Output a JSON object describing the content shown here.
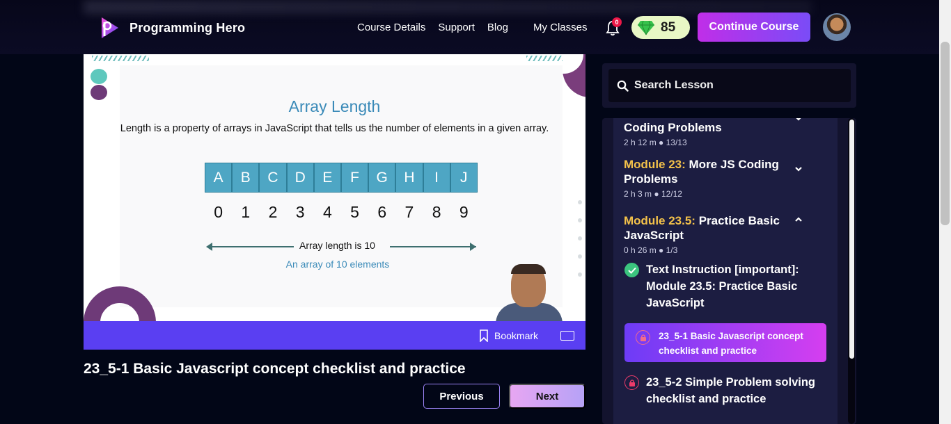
{
  "nav": {
    "brand": "Programming Hero",
    "links": [
      "Course Details",
      "Support",
      "Blog",
      "My Classes"
    ],
    "notification_count": "0",
    "gems": "85",
    "continue_label": "Continue Course"
  },
  "video": {
    "slide_title": "Array Length",
    "slide_subtitle": "Length is a property of arrays in JavaScript that tells us the number of elements in a given array.",
    "cells": [
      "A",
      "B",
      "C",
      "D",
      "E",
      "F",
      "G",
      "H",
      "I",
      "J"
    ],
    "indices": [
      "0",
      "1",
      "2",
      "3",
      "4",
      "5",
      "6",
      "7",
      "8",
      "9"
    ],
    "length_label": "Array length is 10",
    "elements_label": "An array of 10 elements",
    "bookmark_label": "Bookmark"
  },
  "lesson": {
    "title": "23_5-1 Basic Javascript concept checklist and practice",
    "prev_label": "Previous",
    "next_label": "Next"
  },
  "sidebar": {
    "search_placeholder": "Search Lesson",
    "modules": [
      {
        "num": "",
        "name": "Coding Problems",
        "duration": "2 h 12 m",
        "progress": "13/13"
      },
      {
        "num": "Module 23:",
        "name": " More JS Coding Problems",
        "duration": "2 h 3 m",
        "progress": "12/12"
      },
      {
        "num": "Module 23.5:",
        "name": " Practice Basic JavaScript",
        "duration": "0 h 26 m",
        "progress": "1/3"
      }
    ],
    "lessons": [
      {
        "title": "Text Instruction [important]: Module 23.5: Practice Basic JavaScript",
        "status": "done"
      },
      {
        "title": "23_5-1 Basic Javascript concept checklist and practice",
        "status": "active"
      },
      {
        "title": "23_5-2 Simple Problem solving checklist and practice",
        "status": "locked"
      }
    ]
  },
  "colors": {
    "accent_purple": "#5a3ff2",
    "module_number": "#f4c24a",
    "check_green": "#3bc47e",
    "lock_red": "#ec3b6a"
  }
}
